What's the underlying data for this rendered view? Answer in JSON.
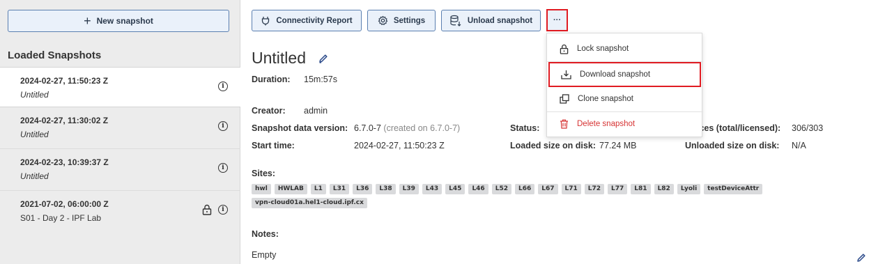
{
  "sidebar": {
    "new_snapshot_label": "New snapshot",
    "title": "Loaded Snapshots",
    "snapshots": [
      {
        "date": "2024-02-27, 11:50:23 Z",
        "name": "Untitled"
      },
      {
        "date": "2024-02-27, 11:30:02 Z",
        "name": "Untitled"
      },
      {
        "date": "2024-02-23, 10:39:37 Z",
        "name": "Untitled"
      },
      {
        "date": "2021-07-02, 06:00:00 Z",
        "name": "S01 - Day 2 - IPF Lab"
      }
    ]
  },
  "toolbar": {
    "connectivity_label": "Connectivity Report",
    "settings_label": "Settings",
    "unload_label": "Unload snapshot",
    "more_label": "···"
  },
  "menu": {
    "lock": "Lock snapshot",
    "download": "Download snapshot",
    "clone": "Clone snapshot",
    "delete": "Delete snapshot"
  },
  "detail": {
    "title": "Untitled",
    "duration_label": "Duration:",
    "duration": "15m:57s",
    "creator_label": "Creator:",
    "creator": "admin",
    "version_label": "Snapshot data version:",
    "version": "6.7.0-7",
    "version_note": "(created on 6.7.0-7)",
    "start_label": "Start time:",
    "start": "2024-02-27, 11:50:23 Z",
    "status_label": "Status:",
    "loaded_size_label": "Loaded size on disk:",
    "loaded_size": "77.24 MB",
    "devices_label": "ices (total/licensed):",
    "devices": "306/303",
    "unloaded_size_label": "Unloaded size on disk:",
    "unloaded_size": "N/A",
    "sites_label": "Sites:",
    "sites": [
      "hwl",
      "HWLAB",
      "L1",
      "L31",
      "L36",
      "L38",
      "L39",
      "L43",
      "L45",
      "L46",
      "L52",
      "L66",
      "L67",
      "L71",
      "L72",
      "L77",
      "L81",
      "L82",
      "Lyoli",
      "testDeviceAttr",
      "vpn-cloud01a.hel1-cloud.ipf.cx"
    ],
    "notes_label": "Notes:",
    "notes": "Empty"
  },
  "colors": {
    "accent_border": "#5a7fb0",
    "button_bg": "#eaf1fa",
    "highlight_red": "#e01b22",
    "danger": "#d63333"
  }
}
